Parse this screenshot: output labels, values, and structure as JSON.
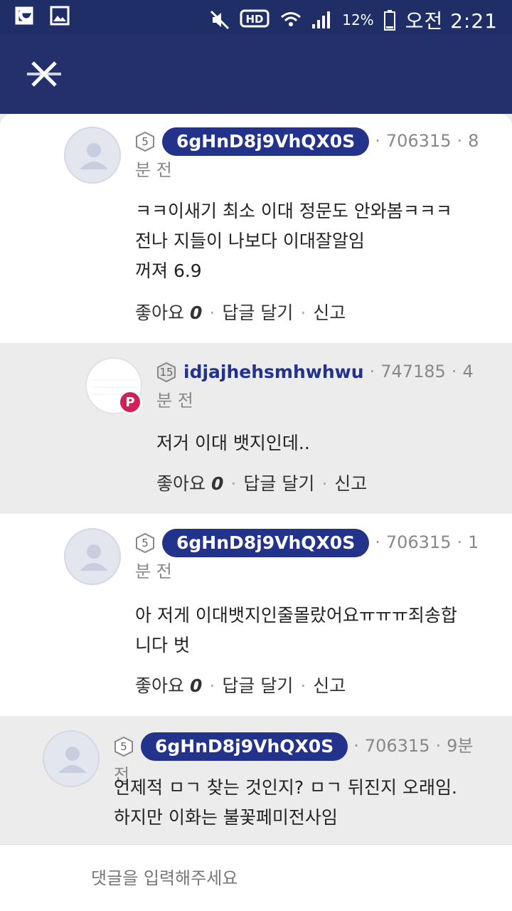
{
  "status_bar": {
    "battery_percent": "12%",
    "clock": "오전 2:21",
    "icons": [
      "o-app-icon",
      "gallery-icon",
      "mute-icon",
      "hd-icon",
      "wifi-icon",
      "signal-icon",
      "battery-icon"
    ]
  },
  "app_bar": {
    "close_icon": "close-x-icon"
  },
  "comments": [
    {
      "level": "5",
      "nickname": "6gHnD8j9VhQX0S",
      "user_id": "706315",
      "time": "8분 전",
      "body": "ㅋㅋ이새기 최소 이대 정문도 안와봄ㅋㅋㅋ\n전나 지들이 나보다 이대잘알임\n꺼져 6.9",
      "like_label": "좋아요",
      "like_count": "0",
      "reply_label": "답글 달기",
      "report_label": "신고"
    },
    {
      "level": "15",
      "nickname": "idjajhehsmhwhwu",
      "user_id": "747185",
      "time": "4분 전",
      "badge": "P",
      "body": "저거 이대 뱃지인데..",
      "like_label": "좋아요",
      "like_count": "0",
      "reply_label": "답글 달기",
      "report_label": "신고"
    },
    {
      "level": "5",
      "nickname": "6gHnD8j9VhQX0S",
      "user_id": "706315",
      "time": "1분 전",
      "body": "아 저게 이대뱃지인줄몰랐어요ㅠㅠㅠ죄송합\n니다 벗",
      "like_label": "좋아요",
      "like_count": "0",
      "reply_label": "답글 달기",
      "report_label": "신고"
    },
    {
      "level": "5",
      "nickname": "6gHnD8j9VhQX0S",
      "user_id": "706315",
      "time": "9분 전",
      "body": "언제적 ㅁㄱ 찾는 것인지? ㅁㄱ 뒤진지 오래임.\n하지만 이화는 불꽃페미전사임"
    }
  ],
  "input": {
    "placeholder": "댓글을 입력해주세요"
  },
  "colors": {
    "header": "#23306b",
    "nickname_pill": "#23328a",
    "badge": "#d21f55"
  }
}
